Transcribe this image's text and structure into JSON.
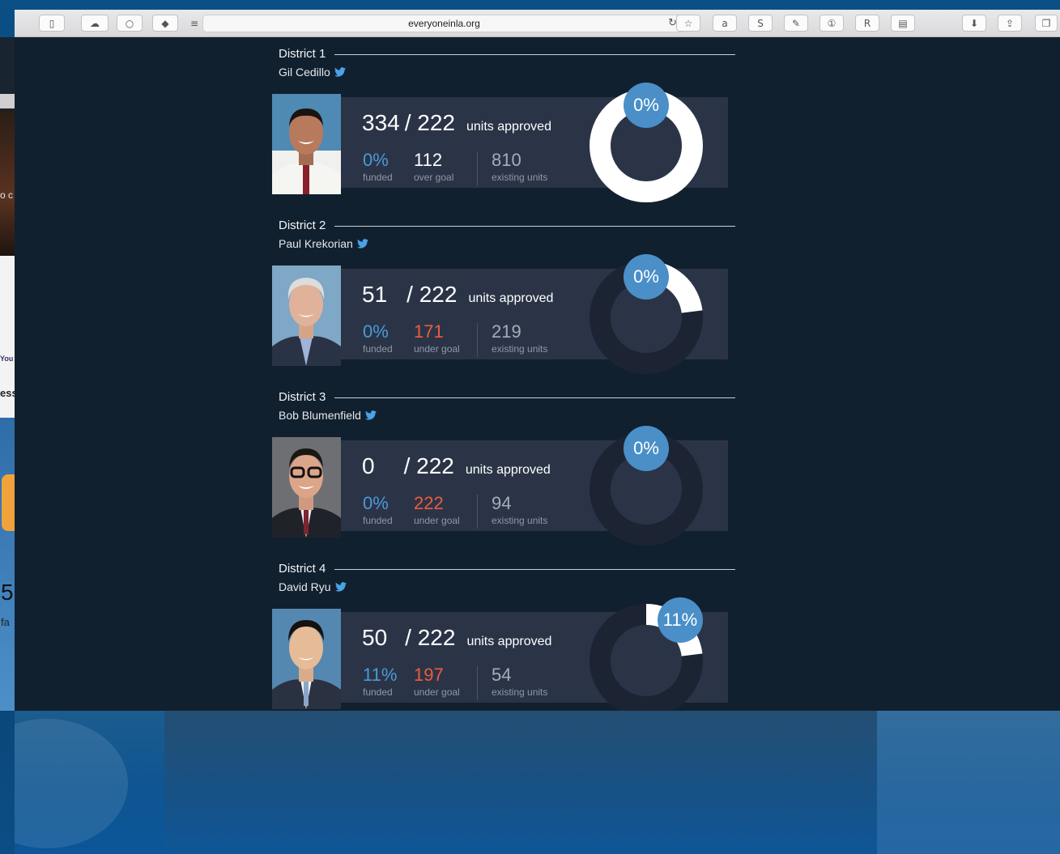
{
  "browser": {
    "url": "everyoneinla.org"
  },
  "background_window": {
    "text_a": "o c",
    "text_b": "You",
    "text_c": "ess",
    "text_num": "5",
    "text_fa": "fa"
  },
  "districts": [
    {
      "title": "District 1",
      "member": "Gil Cedillo",
      "approved": "334",
      "goal": "/ 222",
      "units_label": "units approved",
      "funded_pct": "0%",
      "funded_label": "funded",
      "goal_value": "112",
      "goal_status": "over goal",
      "existing": "810",
      "existing_label": "existing units",
      "pct_bubble": "0%",
      "progress": 1.0
    },
    {
      "title": "District 2",
      "member": "Paul Krekorian",
      "approved": "51",
      "goal": "/ 222",
      "units_label": "units approved",
      "funded_pct": "0%",
      "funded_label": "funded",
      "goal_value": "171",
      "goal_status": "under goal",
      "existing": "219",
      "existing_label": "existing units",
      "pct_bubble": "0%",
      "progress": 0.23
    },
    {
      "title": "District 3",
      "member": "Bob Blumenfield",
      "approved": "0",
      "goal": "/ 222",
      "units_label": "units approved",
      "funded_pct": "0%",
      "funded_label": "funded",
      "goal_value": "222",
      "goal_status": "under goal",
      "existing": "94",
      "existing_label": "existing units",
      "pct_bubble": "0%",
      "progress": 0.0
    },
    {
      "title": "District 4",
      "member": "David Ryu",
      "approved": "50",
      "goal": "/ 222",
      "units_label": "units approved",
      "funded_pct": "11%",
      "funded_label": "funded",
      "goal_value": "197",
      "goal_status": "under goal",
      "existing": "54",
      "existing_label": "existing units",
      "pct_bubble": "11%",
      "progress": 0.23
    }
  ],
  "colors": {
    "accent_blue": "#4a9ad8",
    "under_goal_red": "#ee5b3c",
    "card_bg": "#2b3447",
    "page_bg": "#11202f"
  }
}
